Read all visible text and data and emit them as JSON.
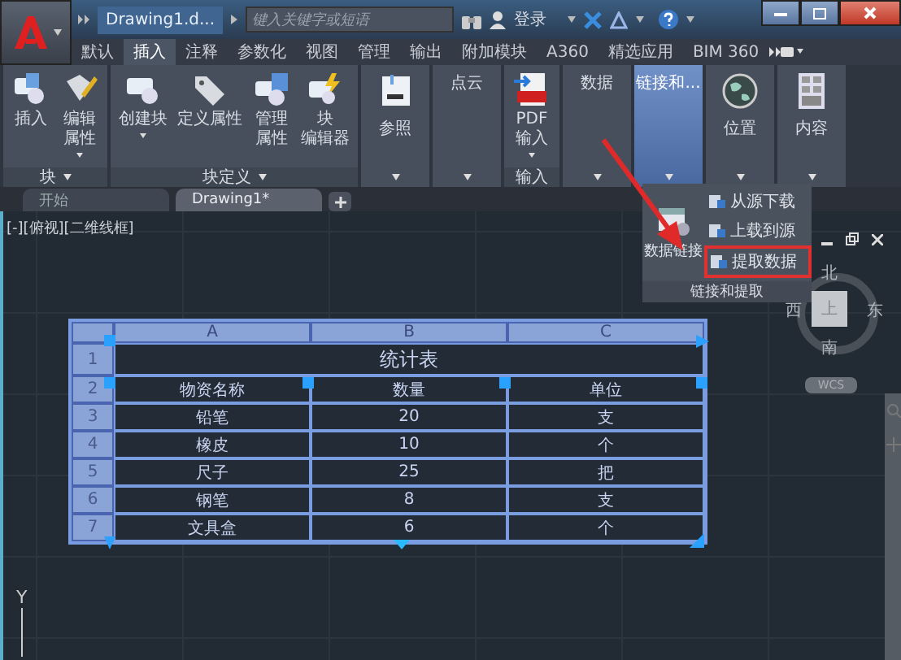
{
  "window": {
    "file_title": "Drawing1.d...",
    "search": {
      "placeholder": "键入关键字或短语"
    },
    "user": "登录"
  },
  "ribbon_tabs": [
    {
      "label": "默认",
      "selected": false
    },
    {
      "label": "插入",
      "selected": true
    },
    {
      "label": "注释",
      "selected": false
    },
    {
      "label": "参数化",
      "selected": false
    },
    {
      "label": "视图",
      "selected": false
    },
    {
      "label": "管理",
      "selected": false
    },
    {
      "label": "输出",
      "selected": false
    },
    {
      "label": "附加模块",
      "selected": false
    },
    {
      "label": "A360",
      "selected": false
    },
    {
      "label": "精选应用",
      "selected": false
    },
    {
      "label": "BIM 360",
      "selected": false
    }
  ],
  "panels": [
    {
      "kind": "buttons",
      "label": "块",
      "menu": true,
      "buttons": [
        {
          "lines": [
            "插入"
          ],
          "menu": false
        },
        {
          "lines": [
            "编辑",
            "属性"
          ],
          "menu": true
        }
      ]
    },
    {
      "kind": "buttons",
      "label": "块定义",
      "menu": true,
      "buttons": [
        {
          "lines": [
            "创建块"
          ],
          "menu": true
        },
        {
          "lines": [
            "定义属性"
          ],
          "menu": false
        },
        {
          "lines": [
            "管理",
            "属性"
          ],
          "menu": false
        },
        {
          "lines": [
            "块",
            "编辑器"
          ],
          "menu": false
        }
      ]
    },
    {
      "kind": "collapsed",
      "title": "参照",
      "selected": false
    },
    {
      "kind": "collapsed",
      "title": "点云",
      "selected": false
    },
    {
      "kind": "buttons",
      "label": "输入",
      "menu": false,
      "buttons": [
        {
          "lines": [
            "PDF",
            "输入"
          ],
          "menu": true
        }
      ]
    },
    {
      "kind": "collapsed",
      "title": "数据",
      "selected": false
    },
    {
      "kind": "collapsed",
      "title": "链接和...",
      "selected": true
    },
    {
      "kind": "collapsed",
      "title": "位置",
      "selected": false
    },
    {
      "kind": "collapsed",
      "title": "内容",
      "selected": false
    }
  ],
  "doc_tabs": [
    {
      "label": "开始",
      "selected": false
    },
    {
      "label": "Drawing1*",
      "selected": true
    }
  ],
  "viewport_label": "[-][俯视][二维线框]",
  "viewcube": {
    "north": "北",
    "south": "南",
    "west": "西",
    "east": "东",
    "face": "上",
    "ucs": "WCS"
  },
  "table": {
    "column_letters": [
      "A",
      "B",
      "C"
    ],
    "row_numbers": [
      "1",
      "2",
      "3",
      "4",
      "5",
      "6",
      "7"
    ],
    "title": "统计表",
    "rows": [
      [
        "物资名称",
        "数量",
        "单位"
      ],
      [
        "铅笔",
        "20",
        "支"
      ],
      [
        "橡皮",
        "10",
        "个"
      ],
      [
        "尺子",
        "25",
        "把"
      ],
      [
        "钢笔",
        "8",
        "支"
      ],
      [
        "文具盒",
        "6",
        "个"
      ]
    ]
  },
  "dropdown": {
    "main_button": "数据链接",
    "items": [
      {
        "label": "从源下载",
        "highlighted": false
      },
      {
        "label": "上载到源",
        "highlighted": false
      },
      {
        "label": "提取数据",
        "highlighted": true
      }
    ],
    "footer": "链接和提取"
  },
  "axis_label": "Y"
}
